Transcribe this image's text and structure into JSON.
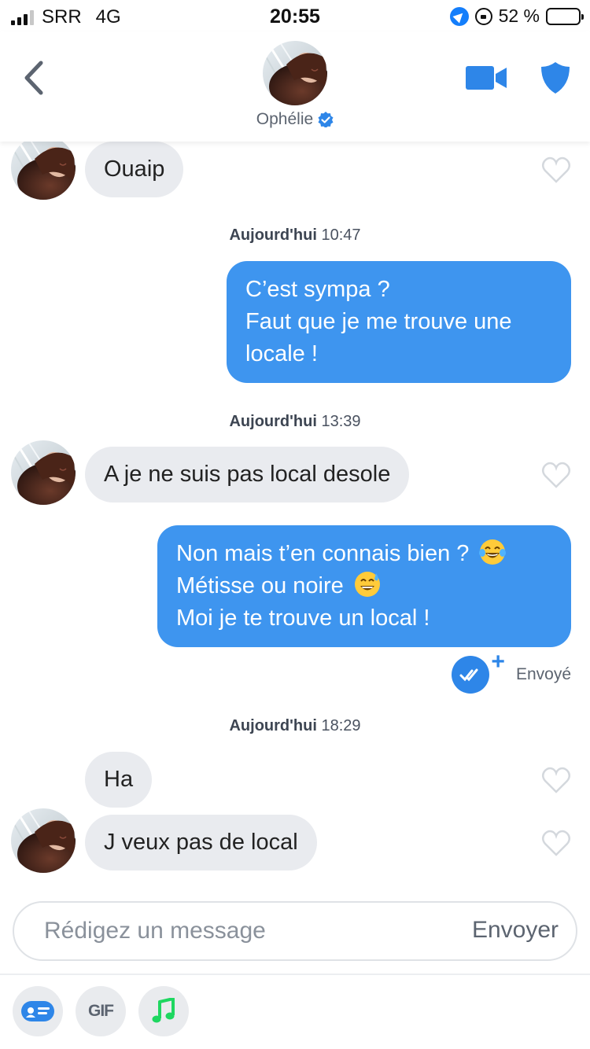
{
  "status_bar": {
    "carrier": "SRR",
    "network": "4G",
    "time": "20:55",
    "battery": "52 %",
    "battery_level": 0.52
  },
  "header": {
    "contact_name": "Ophélie",
    "verified": true,
    "icons": [
      "back-chevron-icon",
      "video-call-icon",
      "safety-shield-icon",
      "verified-badge-icon"
    ]
  },
  "messages": [
    {
      "direction": "in",
      "text": "Ouaip"
    },
    {
      "timestamp_day": "Aujourd'hui",
      "timestamp_time": "10:47"
    },
    {
      "direction": "out",
      "lines": [
        "C’est sympa ?",
        "Faut que je me trouve une",
        "locale !"
      ]
    },
    {
      "timestamp_day": "Aujourd'hui",
      "timestamp_time": "13:39"
    },
    {
      "direction": "in",
      "text": "A je ne suis pas local desole"
    },
    {
      "direction": "out",
      "lines": [
        "Non mais t’en connais bien ?",
        "Métisse ou noire",
        "Moi je te trouve un local !"
      ],
      "emojis": [
        "tears-of-joy-emoji",
        "grinning-sweat-emoji"
      ]
    },
    {
      "status": "Envoyé",
      "status_icon": "read-receipt-icon"
    },
    {
      "timestamp_day": "Aujourd'hui",
      "timestamp_time": "18:29"
    },
    {
      "direction": "in",
      "text": "Ha"
    },
    {
      "direction": "in",
      "text": "J veux pas de local"
    }
  ],
  "composer": {
    "placeholder": "Rédigez un message",
    "value": "",
    "send_label": "Envoyer"
  },
  "toolbar": {
    "gif_label": "GIF",
    "icons": [
      "sticker-card-icon",
      "gif-icon",
      "music-note-icon"
    ]
  },
  "colors": {
    "accent": "#3e95ef",
    "incoming_bubble": "#e9ebef",
    "music_green": "#1ed760"
  }
}
